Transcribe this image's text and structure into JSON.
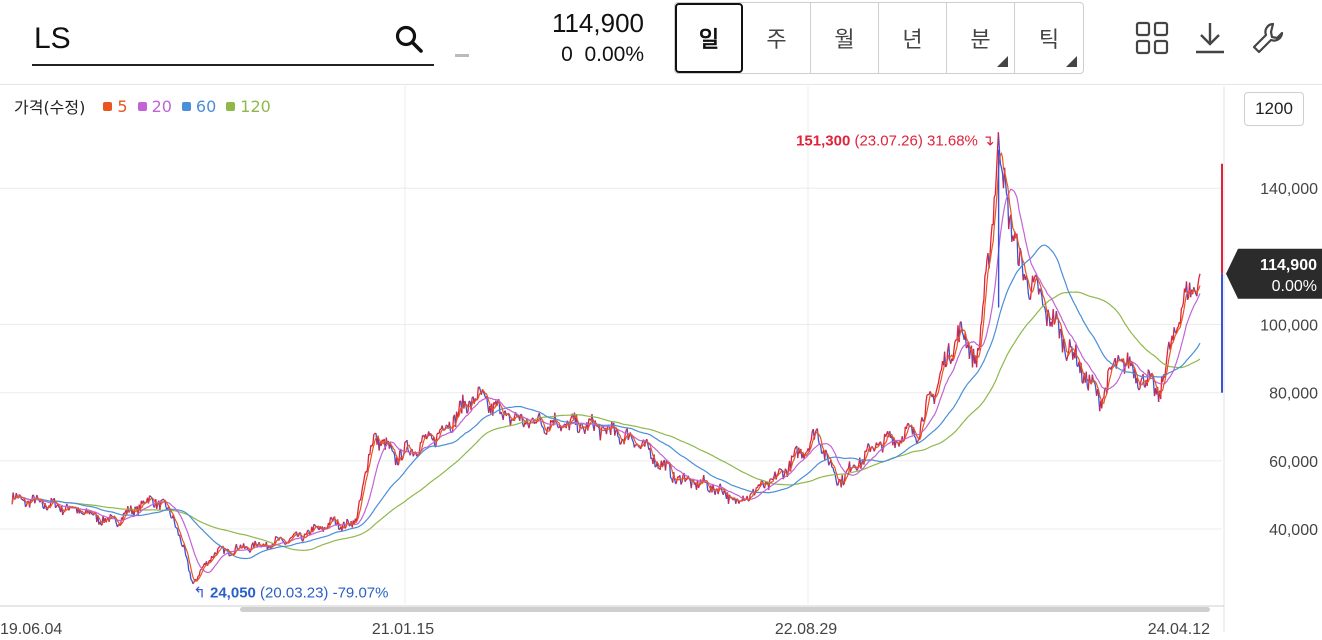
{
  "header": {
    "symbol": "LS",
    "price": "114,900",
    "change": "0",
    "change_pct": "0.00%"
  },
  "tabs": [
    {
      "label": "일",
      "active": true,
      "has_menu": false
    },
    {
      "label": "주",
      "active": false,
      "has_menu": false
    },
    {
      "label": "월",
      "active": false,
      "has_menu": false
    },
    {
      "label": "년",
      "active": false,
      "has_menu": false
    },
    {
      "label": "분",
      "active": false,
      "has_menu": true
    },
    {
      "label": "틱",
      "active": false,
      "has_menu": true
    }
  ],
  "tools": [
    "layout-grid-icon",
    "download-icon",
    "wrench-icon"
  ],
  "legend": {
    "label": "가격(수정)",
    "items": [
      {
        "label": "5",
        "color": "#e8551f"
      },
      {
        "label": "20",
        "color": "#c264d6"
      },
      {
        "label": "60",
        "color": "#4a8fd8"
      },
      {
        "label": "120",
        "color": "#8fb84a"
      }
    ]
  },
  "interval_button": "1200",
  "colors": {
    "up": "#e0223a",
    "down": "#3a52d8",
    "ma5": "#e8551f",
    "ma20": "#c264d6",
    "ma60": "#4a8fd8",
    "ma120": "#8fb84a",
    "grid": "#ececec"
  },
  "chart_data": {
    "type": "line",
    "title": "",
    "y_ticks": [
      40000,
      60000,
      80000,
      100000,
      140000
    ],
    "y_tick_labels": [
      "40,000",
      "60,000",
      "80,000",
      "100,000",
      "140,000"
    ],
    "ylim": [
      18000,
      170000
    ],
    "x_tick_labels": [
      "19.06.04",
      "21.01.15",
      "22.08.29",
      "24.04.12"
    ],
    "current_price_label": "114,900",
    "current_change_label": "0.00%",
    "current_price": 114900,
    "annotations": {
      "high": {
        "value": "151,300",
        "detail": "(23.07.26) 31.68%",
        "price": 151300
      },
      "low": {
        "value": "24,050",
        "detail": "(20.03.23) -79.07%",
        "price": 24050
      }
    },
    "price_path": [
      [
        "19.06",
        49000
      ],
      [
        "19.09",
        46000
      ],
      [
        "19.11",
        42000
      ],
      [
        "20.01",
        49000
      ],
      [
        "20.02",
        44000
      ],
      [
        "20.03",
        24050
      ],
      [
        "20.04",
        33000
      ],
      [
        "20.06",
        35000
      ],
      [
        "20.08",
        37000
      ],
      [
        "20.10",
        42000
      ],
      [
        "20.11",
        41000
      ],
      [
        "20.12",
        68000
      ],
      [
        "21.01",
        61000
      ],
      [
        "21.03",
        67000
      ],
      [
        "21.05",
        79000
      ],
      [
        "21.07",
        72000
      ],
      [
        "21.09",
        71000
      ],
      [
        "21.11",
        70000
      ],
      [
        "22.01",
        66000
      ],
      [
        "22.03",
        55000
      ],
      [
        "22.05",
        52000
      ],
      [
        "22.06",
        48000
      ],
      [
        "22.08",
        55000
      ],
      [
        "22.10",
        68000
      ],
      [
        "22.11",
        54000
      ],
      [
        "23.01",
        65000
      ],
      [
        "23.03",
        69000
      ],
      [
        "23.05",
        98000
      ],
      [
        "23.06",
        90000
      ],
      [
        "23.07",
        151300
      ],
      [
        "23.08",
        118000
      ],
      [
        "23.10",
        98000
      ],
      [
        "23.12",
        78000
      ],
      [
        "24.01",
        90000
      ],
      [
        "24.03",
        80000
      ],
      [
        "24.04",
        104000
      ],
      [
        "24.05",
        114900
      ]
    ]
  }
}
